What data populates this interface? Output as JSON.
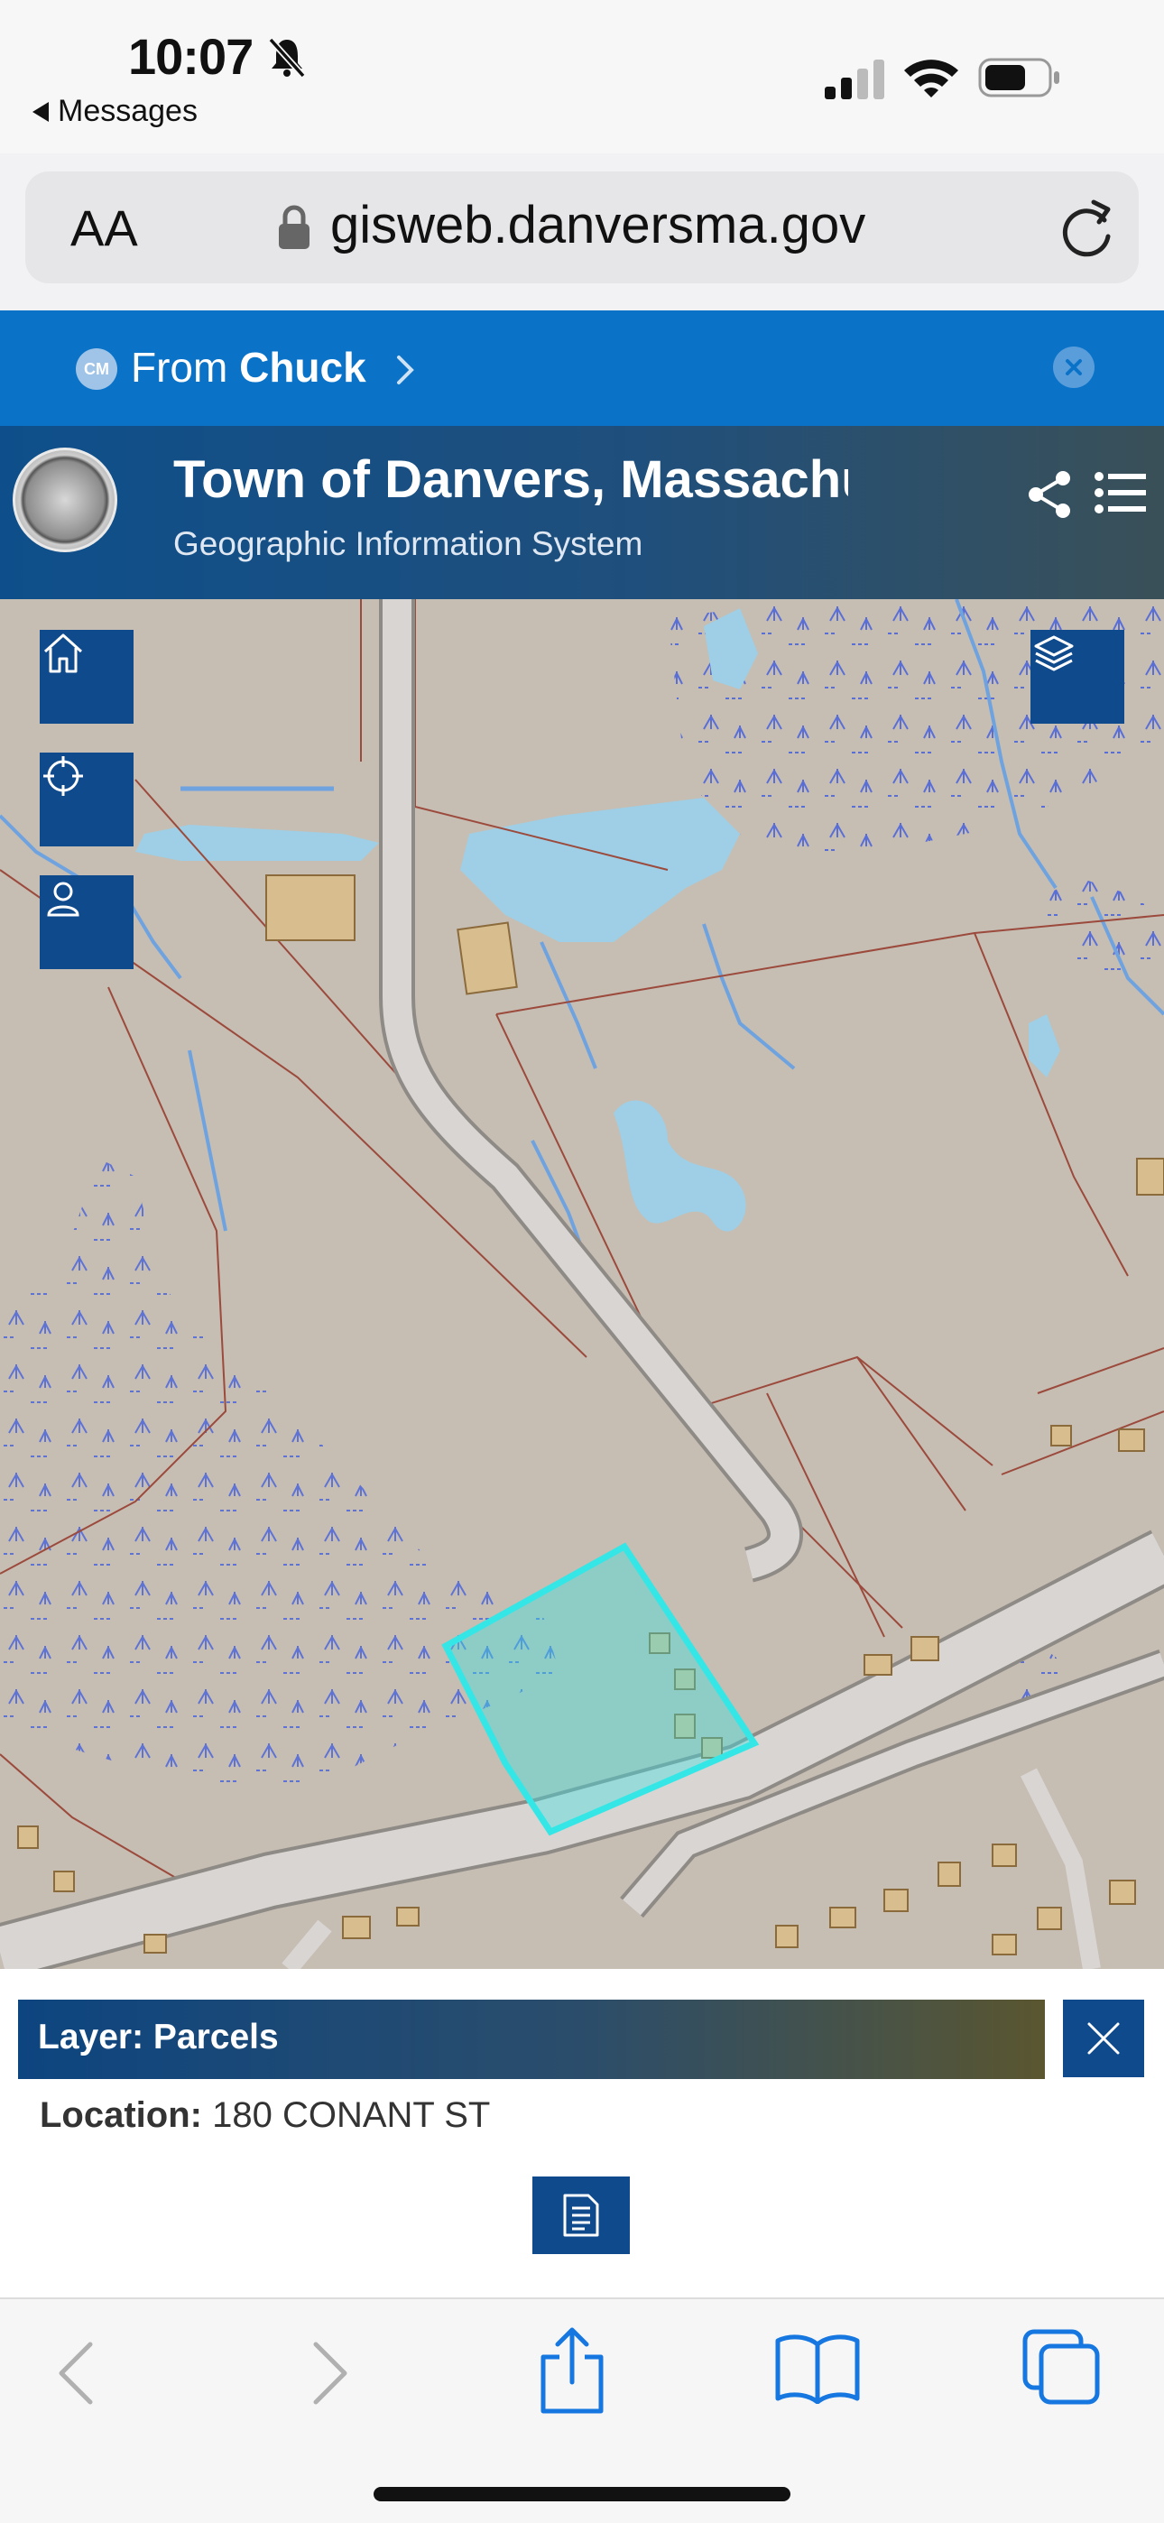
{
  "status_bar": {
    "time": "10:07",
    "back_label": "Messages"
  },
  "browser": {
    "text_size_button": "AA",
    "url": "gisweb.danversma.gov"
  },
  "shared_banner": {
    "avatar_initials": "CM",
    "from_prefix": "From",
    "from_name": "Chuck"
  },
  "site_header": {
    "title": "Town of Danvers, Massachusetts",
    "subtitle": "Geographic Information System"
  },
  "map": {
    "selected_parcel_color": "#35e6e6",
    "water_color": "#9ecfe6",
    "land_color": "#c7bdb4",
    "road_color": "#d9d5d2",
    "parcel_line_color": "#9b4a3c",
    "building_color": "#d8be8e",
    "controls": [
      "home-icon",
      "locate-icon",
      "user-icon",
      "layers-icon"
    ]
  },
  "info_panel": {
    "layer_title": "Layer: Parcels",
    "location_label": "Location:",
    "location_value": "180 CONANT ST"
  },
  "toolbar": {
    "icons": [
      "back-icon",
      "forward-icon",
      "share-icon",
      "bookmarks-icon",
      "tabs-icon"
    ]
  }
}
